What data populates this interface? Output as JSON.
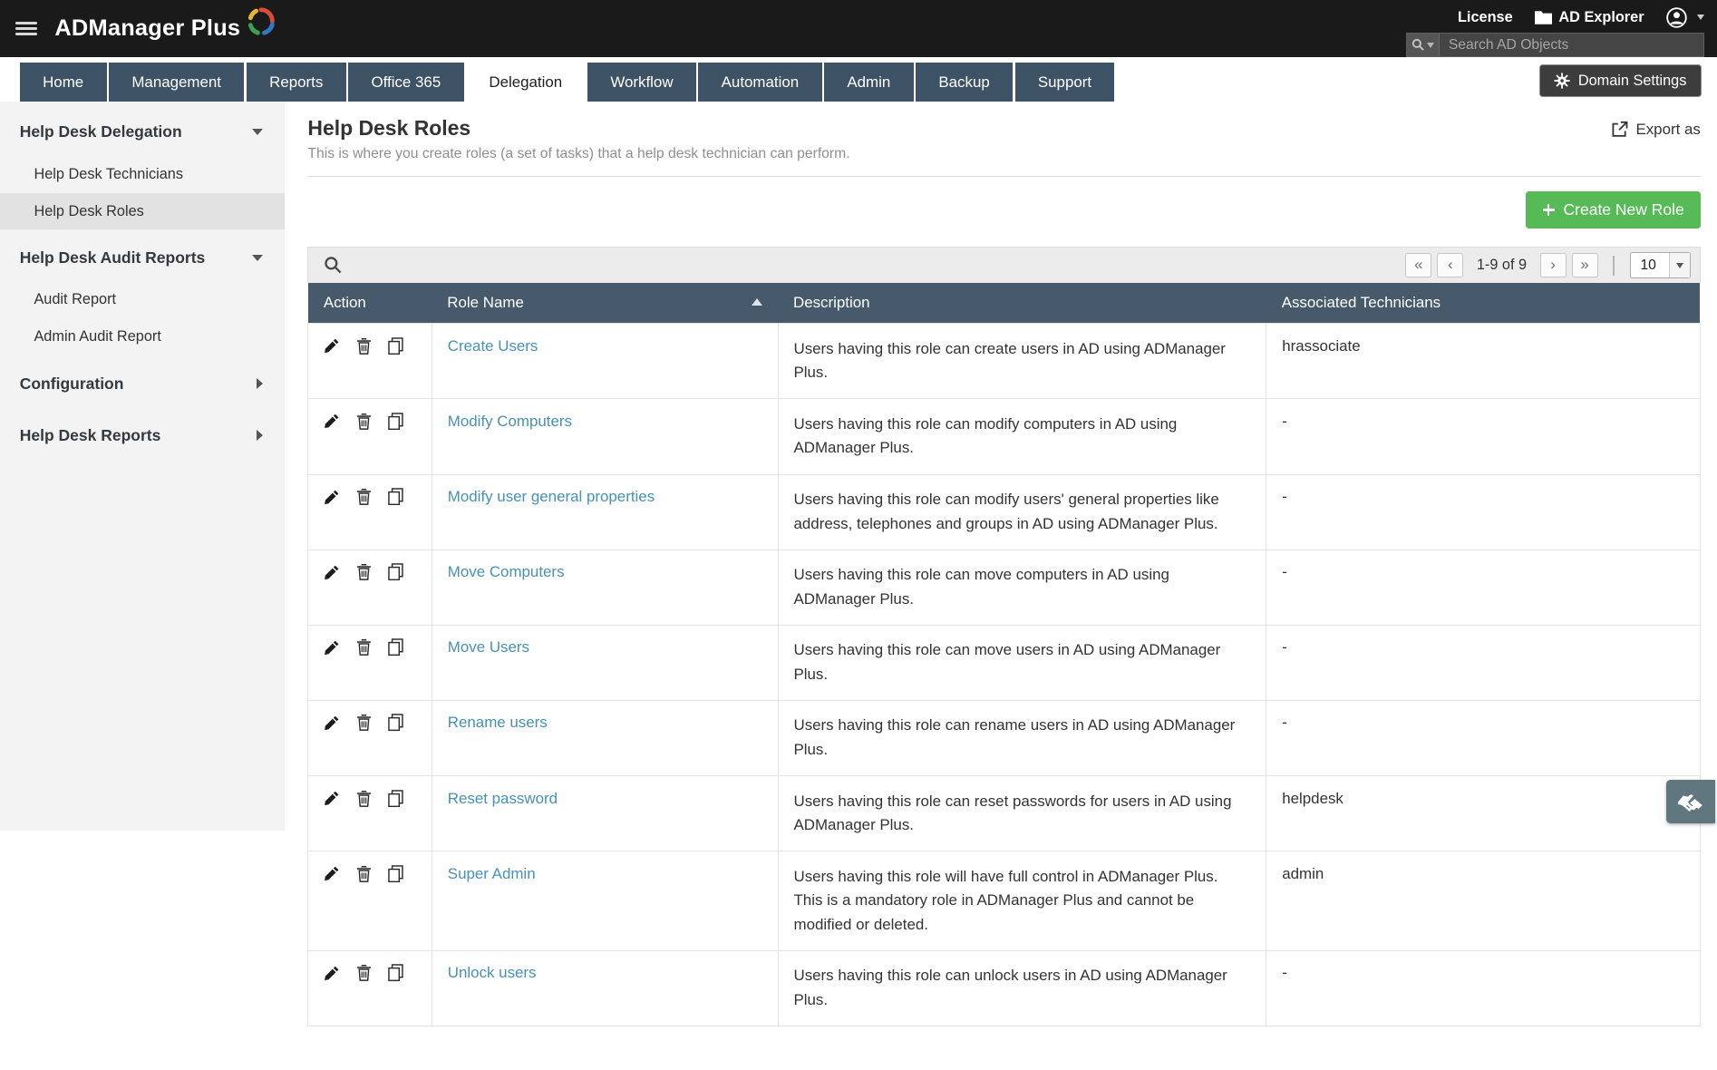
{
  "topbar": {
    "logo": "ADManager Plus",
    "license_label": "License",
    "ad_explorer_label": "AD Explorer",
    "search_placeholder": "Search AD Objects"
  },
  "nav": {
    "tabs": [
      "Home",
      "Management",
      "Reports",
      "Office 365",
      "Delegation",
      "Workflow",
      "Automation",
      "Admin",
      "Backup",
      "Support"
    ],
    "active_tab": "Delegation",
    "domain_settings_label": "Domain Settings"
  },
  "sidebar": {
    "sections": [
      {
        "label": "Help Desk Delegation",
        "expanded": true,
        "items": [
          "Help Desk Technicians",
          "Help Desk Roles"
        ]
      },
      {
        "label": "Help Desk Audit Reports",
        "expanded": true,
        "items": [
          "Audit Report",
          "Admin Audit Report"
        ]
      },
      {
        "label": "Configuration",
        "expanded": false,
        "items": []
      },
      {
        "label": "Help Desk Reports",
        "expanded": false,
        "items": []
      }
    ],
    "selected_item": "Help Desk Roles"
  },
  "page": {
    "title": "Help Desk Roles",
    "subtitle": "This is where you create roles (a set of tasks) that a help desk technician can perform.",
    "export_label": "Export as",
    "create_role_label": "Create New Role"
  },
  "toolbar": {
    "pagination_range": "1-9 of 9",
    "page_size": "10",
    "icons": {
      "first": "«",
      "prev": "‹",
      "next": "›",
      "last": "»"
    }
  },
  "table": {
    "headers": {
      "action": "Action",
      "role_name": "Role Name",
      "description": "Description",
      "technicians": "Associated Technicians"
    },
    "rows": [
      {
        "role": "Create Users",
        "description": "Users having this role can create users in AD using ADManager Plus.",
        "technicians": "hrassociate"
      },
      {
        "role": "Modify Computers",
        "description": "Users having this role can modify computers in AD using ADManager Plus.",
        "technicians": "-"
      },
      {
        "role": "Modify user general properties",
        "description": "Users having this role can modify users' general properties like address, telephones and groups in AD using ADManager Plus.",
        "technicians": "-"
      },
      {
        "role": "Move Computers",
        "description": "Users having this role can move computers in AD using ADManager Plus.",
        "technicians": "-"
      },
      {
        "role": "Move Users",
        "description": "Users having this role can move users in AD using ADManager Plus.",
        "technicians": "-"
      },
      {
        "role": "Rename users",
        "description": "Users having this role can rename users in AD using ADManager Plus.",
        "technicians": "-"
      },
      {
        "role": "Reset password",
        "description": "Users having this role can reset passwords for users in AD using ADManager Plus.",
        "technicians": "helpdesk"
      },
      {
        "role": "Super Admin",
        "description": "Users having this role will have full control in ADManager Plus. This is a mandatory role in ADManager Plus and cannot be modified or deleted.",
        "technicians": "admin"
      },
      {
        "role": "Unlock users",
        "description": "Users having this role can unlock users in AD using ADManager Plus.",
        "technicians": "-"
      }
    ]
  }
}
